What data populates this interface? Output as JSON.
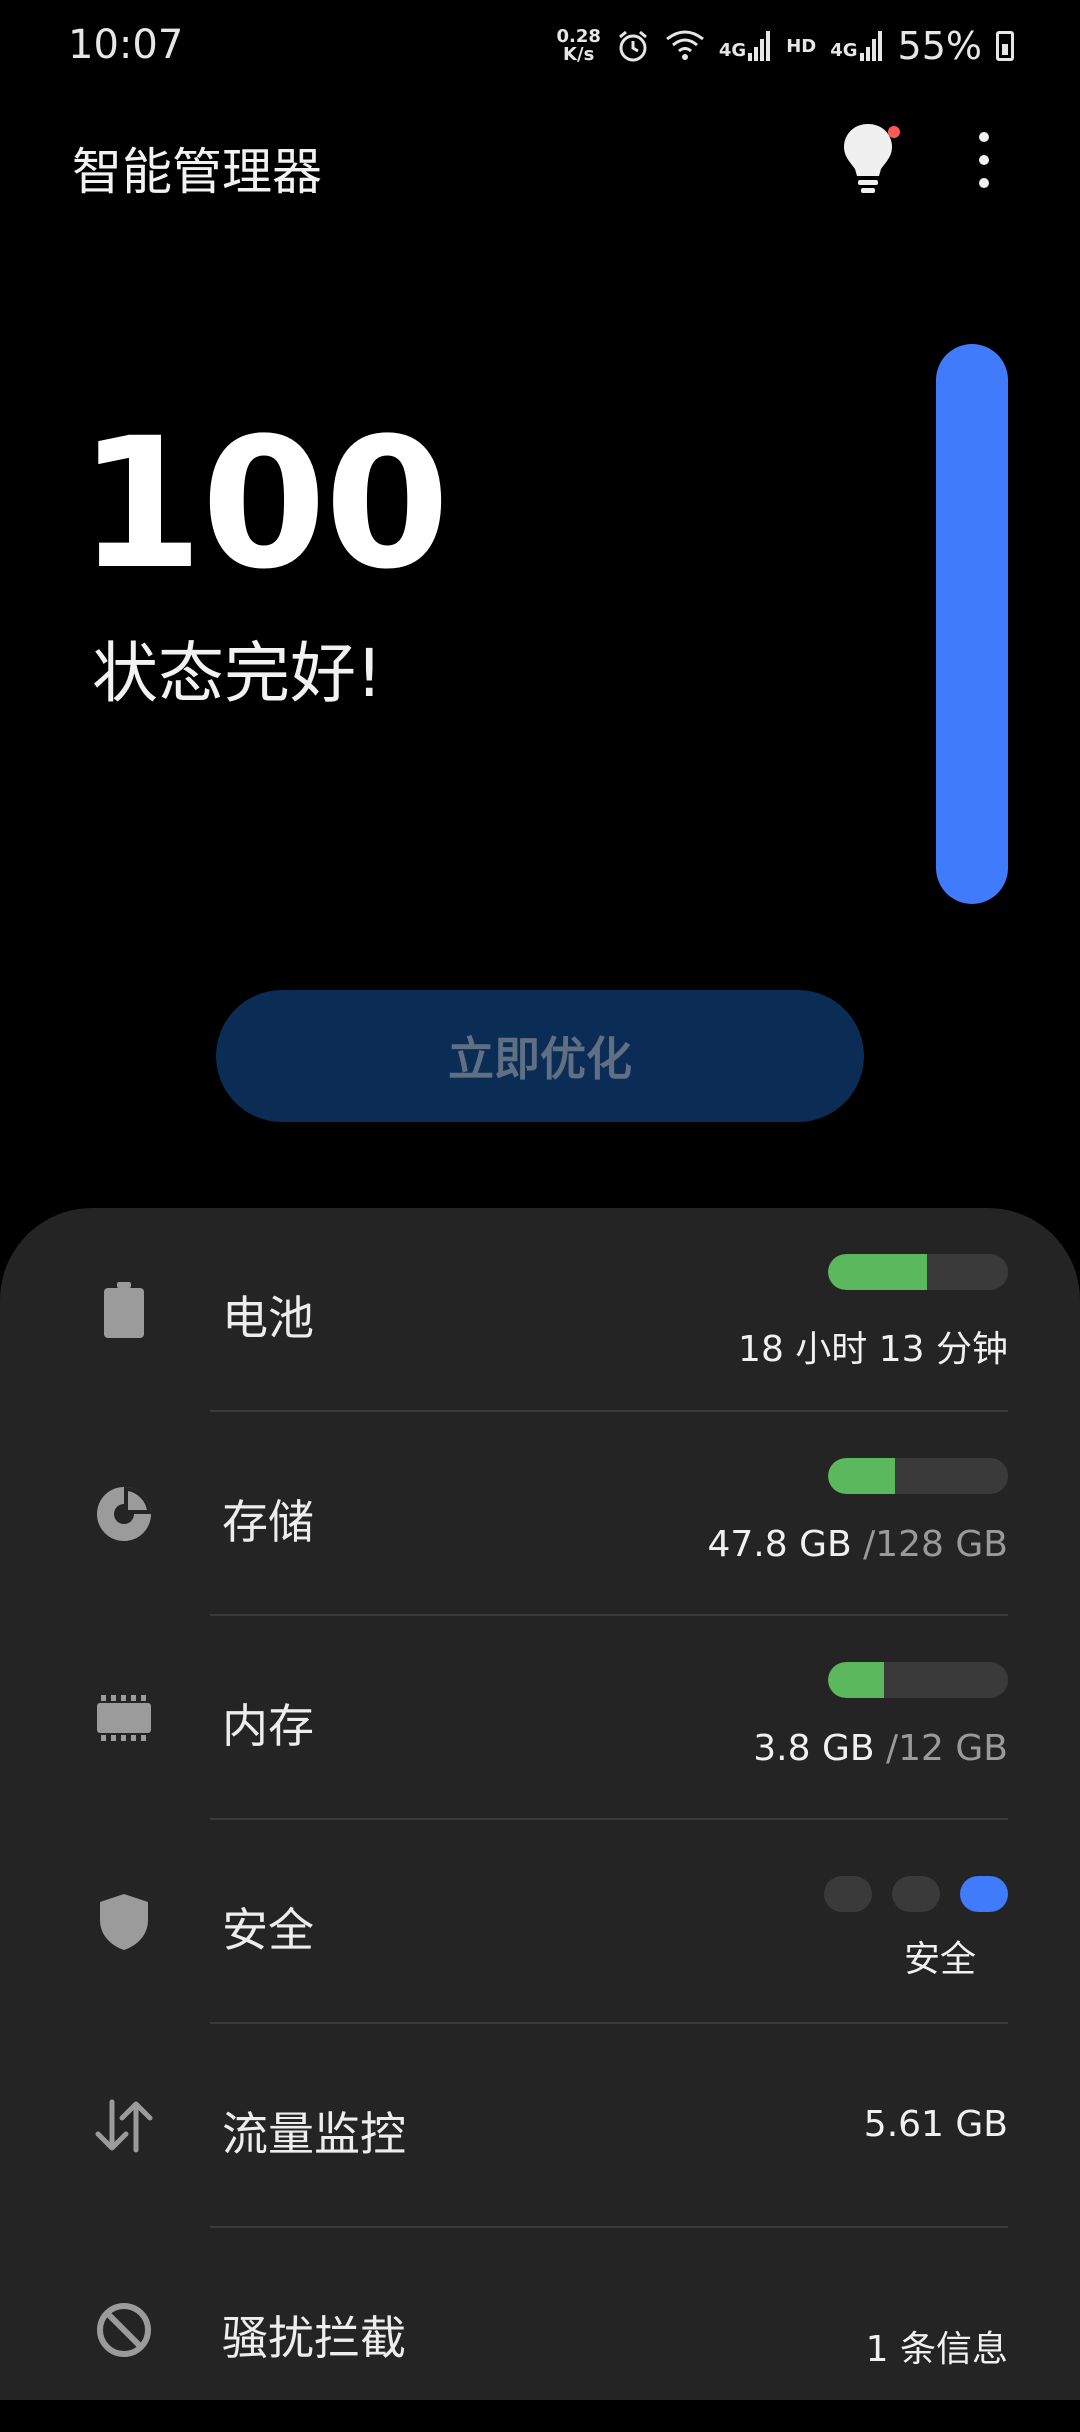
{
  "status_bar": {
    "time": "10:07",
    "net_speed_value": "0.28",
    "net_speed_unit": "K/s",
    "hd_label": "HD",
    "net1": "4G",
    "net2": "4G",
    "battery_pct": "55%"
  },
  "app_bar": {
    "title": "智能管理器"
  },
  "score": {
    "value": "100",
    "status": "状态完好!",
    "bar_fill": 1.0
  },
  "optimize_button": {
    "label": "立即优化"
  },
  "items": {
    "battery": {
      "label": "电池",
      "value": "18 小时 13 分钟",
      "progress": 0.55
    },
    "storage": {
      "label": "存储",
      "used": "47.8 GB",
      "total": " /128 GB",
      "progress": 0.37
    },
    "memory": {
      "label": "内存",
      "used": "3.8 GB",
      "total": " /12 GB",
      "progress": 0.31
    },
    "security": {
      "label": "安全",
      "value": "安全",
      "level": 3,
      "levels": 3
    },
    "data_usage": {
      "label": "流量监控",
      "value": "5.61 GB"
    },
    "call_block": {
      "label": "骚扰拦截",
      "value": "1 条信息"
    }
  },
  "colors": {
    "accent_blue": "#3f7bfb",
    "progress_green": "#5cb85c",
    "card_bg": "#242424",
    "button_bg": "#0a2c55"
  }
}
